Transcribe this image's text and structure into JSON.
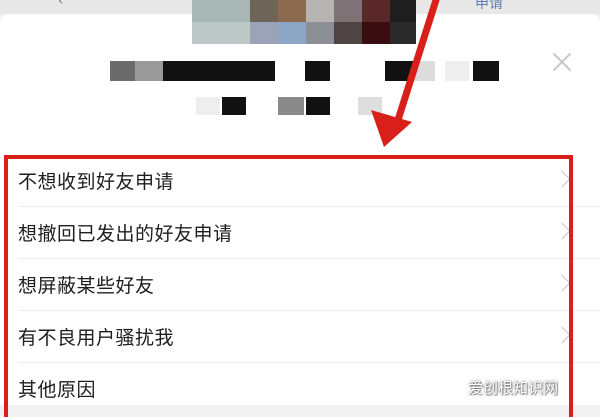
{
  "header": {
    "back_label": "‹",
    "apply_label": "申请"
  },
  "menu": {
    "items": [
      {
        "label": "不想收到好友申请"
      },
      {
        "label": "想撤回已发出的好友申请"
      },
      {
        "label": "想屏蔽某些好友"
      },
      {
        "label": "有不良用户骚扰我"
      },
      {
        "label": "其他原因"
      }
    ]
  },
  "watermark": "爱创根知识网",
  "colors": {
    "highlight": "#d91f1a",
    "background": "#ffffff",
    "text": "#1e1e1e"
  }
}
